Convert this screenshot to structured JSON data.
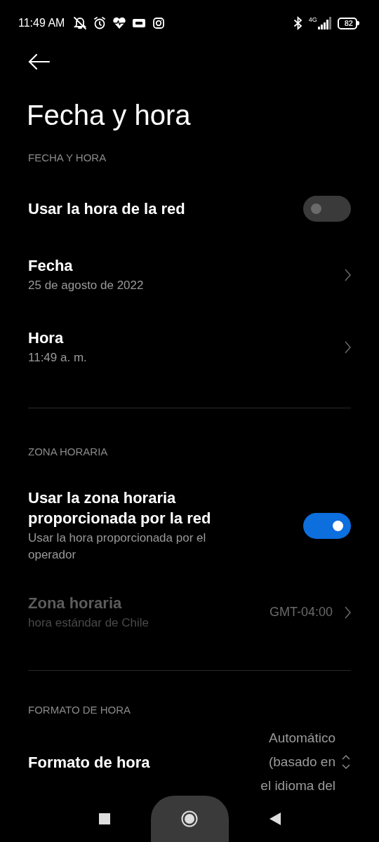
{
  "status_bar": {
    "time": "11:49 AM",
    "network": "4G",
    "battery": "82"
  },
  "title": "Fecha y hora",
  "sections": [
    {
      "header": "FECHA Y HORA",
      "items": [
        {
          "kind": "toggle",
          "title": "Usar la hora de la red",
          "on": false,
          "disabled": false
        },
        {
          "kind": "nav",
          "title": "Fecha",
          "subtitle": "25 de agosto de 2022",
          "disabled": false
        },
        {
          "kind": "nav",
          "title": "Hora",
          "subtitle": "11:49 a. m.",
          "disabled": false
        }
      ]
    },
    {
      "header": "ZONA HORARIA",
      "items": [
        {
          "kind": "toggle",
          "title": "Usar la zona horaria proporcionada por la red",
          "subtitle": "Usar la hora proporcionada por el operador",
          "on": true,
          "disabled": false
        },
        {
          "kind": "nav",
          "title": "Zona horaria",
          "subtitle": "hora estándar de Chile",
          "value": "GMT-04:00",
          "disabled": true
        }
      ]
    },
    {
      "header": "FORMATO DE HORA",
      "items": [
        {
          "kind": "select",
          "title": "Formato de hora",
          "value": "Automático (basado en el idioma del",
          "disabled": false
        }
      ]
    }
  ]
}
